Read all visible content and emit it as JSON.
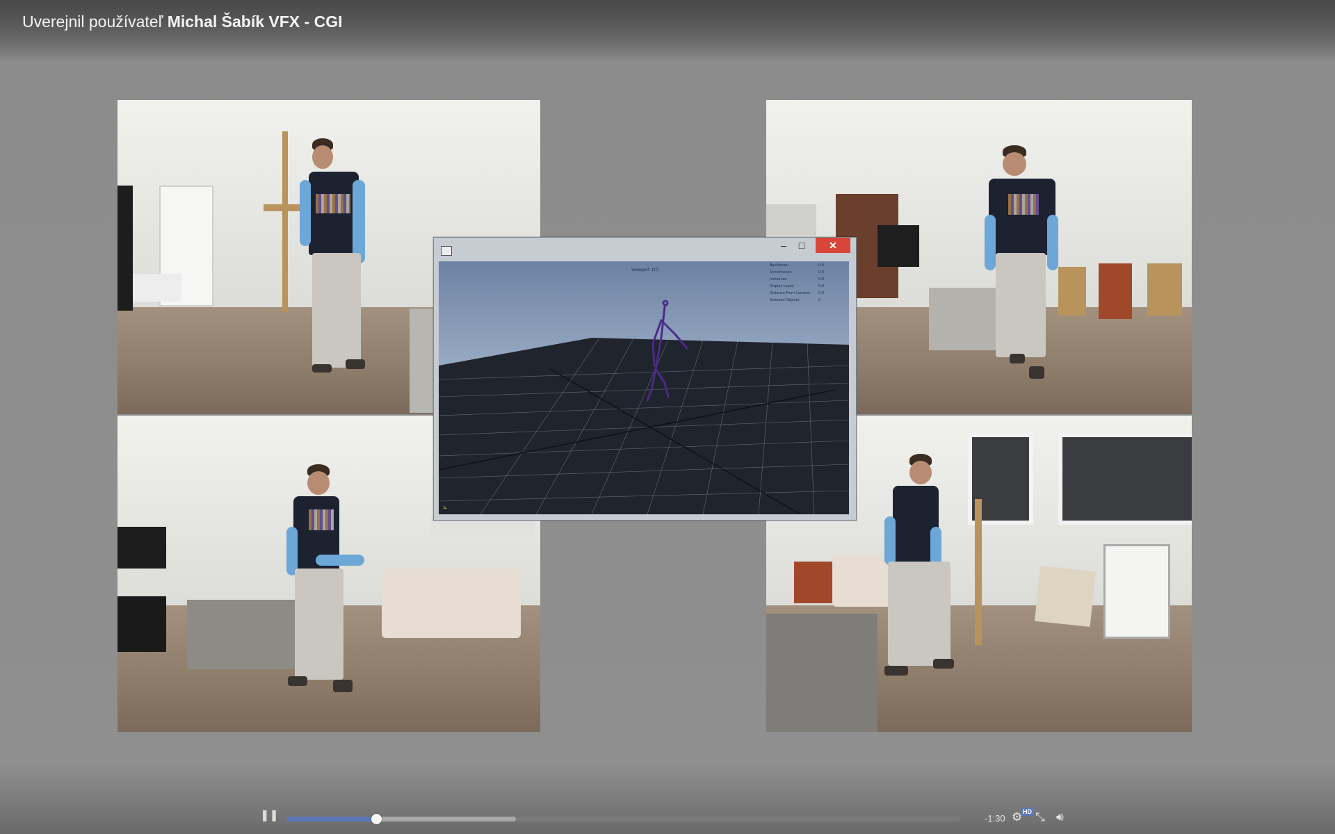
{
  "header": {
    "posted_by_prefix": "Uverejnil používateľ",
    "author": "Michal Šabík VFX - CGI"
  },
  "app_window": {
    "minimize_glyph": "–",
    "maximize_glyph": "□",
    "close_glyph": "✕",
    "viewport_title": "Viewport 1(f)",
    "hud": [
      {
        "label": "Backfaces:",
        "value": "0:0"
      },
      {
        "label": "Smoothness:",
        "value": "0:0"
      },
      {
        "label": "Instances:",
        "value": "0:0"
      },
      {
        "label": "Display Layer:",
        "value": "0:0"
      },
      {
        "label": "Distance From Camera:",
        "value": "0:0"
      },
      {
        "label": "Selected Objects:",
        "value": "0"
      }
    ]
  },
  "player": {
    "pause_glyph": "❚❚",
    "time_remaining": "-1:30",
    "hd_label": "HD",
    "progress_played": 0.133,
    "progress_buffered": 0.34,
    "icons": {
      "settings": "gear-icon",
      "fullscreen_exit": "fullscreen-exit-icon",
      "volume": "volume-icon"
    }
  },
  "colors": {
    "accent": "#5b78b8",
    "close_button": "#d9453a",
    "rig": "#4b2a8a"
  }
}
